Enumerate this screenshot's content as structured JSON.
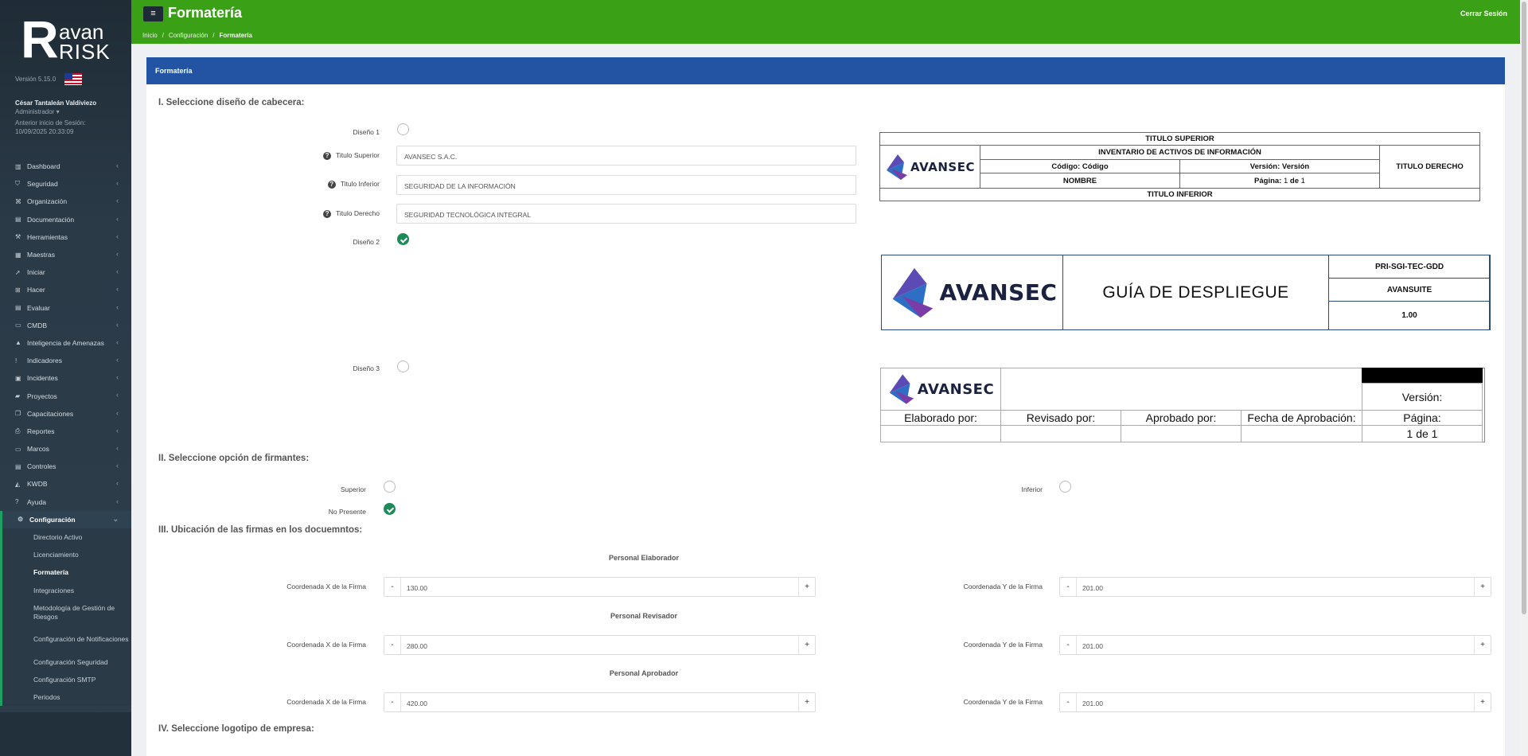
{
  "app": {
    "logo_r": "R",
    "logo_avan": "avan",
    "logo_risk": "RISK",
    "version": "Versión 5.15.0"
  },
  "user": {
    "name": "César Tantaleán Valdiviezo",
    "role": "Administrador ▾",
    "last_session_label": "Anterior inicio de Sesión:",
    "last_session": "10/09/2025 20:33:09"
  },
  "sidebar": {
    "items": [
      {
        "label": "Dashboard",
        "icon": "chart-icon"
      },
      {
        "label": "Seguridad",
        "icon": "shield-icon"
      },
      {
        "label": "Organización",
        "icon": "sitemap-icon"
      },
      {
        "label": "Documentación",
        "icon": "file-icon"
      },
      {
        "label": "Herramientas",
        "icon": "tools-icon"
      },
      {
        "label": "Maestras",
        "icon": "table-icon"
      },
      {
        "label": "Iniciar",
        "icon": "rocket-icon"
      },
      {
        "label": "Hacer",
        "icon": "plus-square-icon"
      },
      {
        "label": "Evaluar",
        "icon": "document-icon"
      },
      {
        "label": "CMDB",
        "icon": "monitor-icon"
      },
      {
        "label": "Inteligencia de Amenazas",
        "icon": "warning-icon"
      },
      {
        "label": "Indicadores",
        "icon": "exclamation-icon"
      },
      {
        "label": "Incidentes",
        "icon": "briefcase-icon"
      },
      {
        "label": "Proyectos",
        "icon": "folder-icon"
      },
      {
        "label": "Capacitaciones",
        "icon": "copy-icon"
      },
      {
        "label": "Reportes",
        "icon": "print-icon"
      },
      {
        "label": "Marcos",
        "icon": "inbox-icon"
      },
      {
        "label": "Controles",
        "icon": "page-icon"
      },
      {
        "label": "KWDB",
        "icon": "graduation-icon"
      },
      {
        "label": "Ayuda",
        "icon": "help-circle-icon"
      },
      {
        "label": "Configuración",
        "icon": "gear-icon"
      }
    ],
    "sub_items": [
      "Directorio Activo",
      "Licenciamiento",
      "Formatería",
      "Integraciones",
      "Metodología de Gestión de Riesgos",
      "Configuración de Notificaciones",
      "Configuración Seguridad",
      "Configuración SMTP",
      "Periodos"
    ]
  },
  "header": {
    "menu_icon": "≡",
    "title": "Formatería",
    "logout": "Cerrar Sesión",
    "breadcrumb": [
      "Inicio",
      "Configuración",
      "Formatería"
    ]
  },
  "panel": {
    "title": "Formatería"
  },
  "section1": {
    "title": "I. Seleccione diseño de cabecera:",
    "design1_label": "Diseño 1",
    "design2_label": "Diseño 2",
    "design3_label": "Diseño 3",
    "selected_design": 2,
    "fields": [
      {
        "label": "Titulo Superior",
        "value": "AVANSEC S.A.C."
      },
      {
        "label": "Titulo Inferior",
        "value": "SEGURIDAD DE LA INFORMACIÓN"
      },
      {
        "label": "Titulo Derecho",
        "value": "SEGURIDAD TECNOLÓGICA INTEGRAL"
      }
    ]
  },
  "preview1": {
    "top": "TITULO SUPERIOR",
    "doc": "INVENTARIO DE ACTIVOS DE INFORMACIÓN",
    "code_label": "Código:",
    "code": "Código",
    "version_label": "Versión:",
    "version": "Versión",
    "name": "NOMBRE",
    "page_label": "Página:",
    "page": "1",
    "of": "de",
    "total": "1",
    "right": "TITULO DERECHO",
    "bottom": "TITULO INFERIOR",
    "brand": "AVANSEC"
  },
  "preview2": {
    "brand": "AVANSEC",
    "title": "GUÍA DE DESPLIEGUE",
    "code": "PRI-SGI-TEC-GDD",
    "suite": "AVANSUITE",
    "version": "1.00"
  },
  "preview3": {
    "brand": "AVANSEC",
    "version_label": "Versión:",
    "elaborated": "Elaborado por:",
    "reviewed": "Revisado por:",
    "approved": "Aprobado por:",
    "approval_date": "Fecha de Aprobación:",
    "page_label": "Página:",
    "page_value": "1 de 1"
  },
  "section2": {
    "title": "II. Seleccione opción de firmantes:",
    "upper": "Superior",
    "lower": "Inferior",
    "none": "No Presente",
    "selected": "No Presente"
  },
  "section3": {
    "title": "III. Ubicación de las firmas en los docuemntos:",
    "x_label": "Coordenada X de la Firma",
    "y_label": "Coordenada Y de la Firma",
    "rows": [
      {
        "title": "Personal Elaborador",
        "x": "130.00",
        "y": "201.00"
      },
      {
        "title": "Personal Revisador",
        "x": "280.00",
        "y": "201.00"
      },
      {
        "title": "Personal Aprobador",
        "x": "420.00",
        "y": "201.00"
      }
    ]
  },
  "section4": {
    "title": "IV. Seleccione logotipo de empresa:"
  },
  "colors": {
    "header_green": "#3aa116",
    "panel_blue": "#2254a3",
    "check_green": "#1e8a5a",
    "sidebar": "#2a3a47"
  }
}
